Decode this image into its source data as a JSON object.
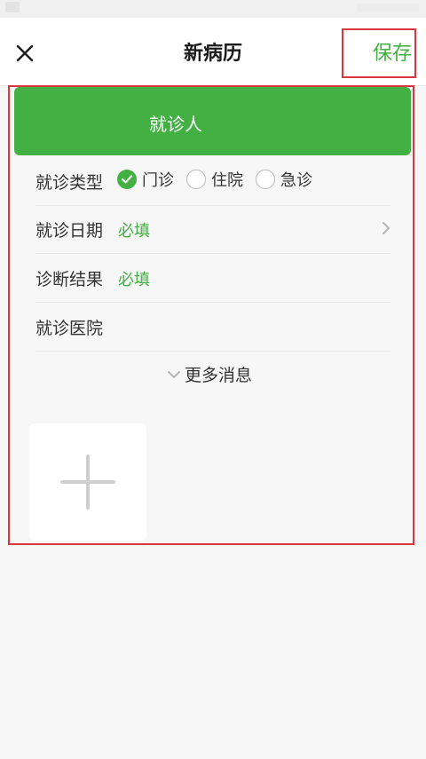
{
  "header": {
    "title": "新病历",
    "save_label": "保存"
  },
  "visit_card": {
    "label": "就诊人"
  },
  "form": {
    "visit_type": {
      "label": "就诊类型",
      "options": [
        "门诊",
        "住院",
        "急诊"
      ],
      "selected": "门诊"
    },
    "visit_date": {
      "label": "就诊日期",
      "placeholder": "必填"
    },
    "diagnosis": {
      "label": "诊断结果",
      "placeholder": "必填"
    },
    "hospital": {
      "label": "就诊医院"
    }
  },
  "more_label": "更多消息",
  "icons": [
    "close-icon",
    "chevron-right-icon",
    "chevron-down-icon",
    "check-icon",
    "plus-icon"
  ],
  "colors": {
    "accent": "#43b043",
    "highlight_border": "#d9363e"
  }
}
